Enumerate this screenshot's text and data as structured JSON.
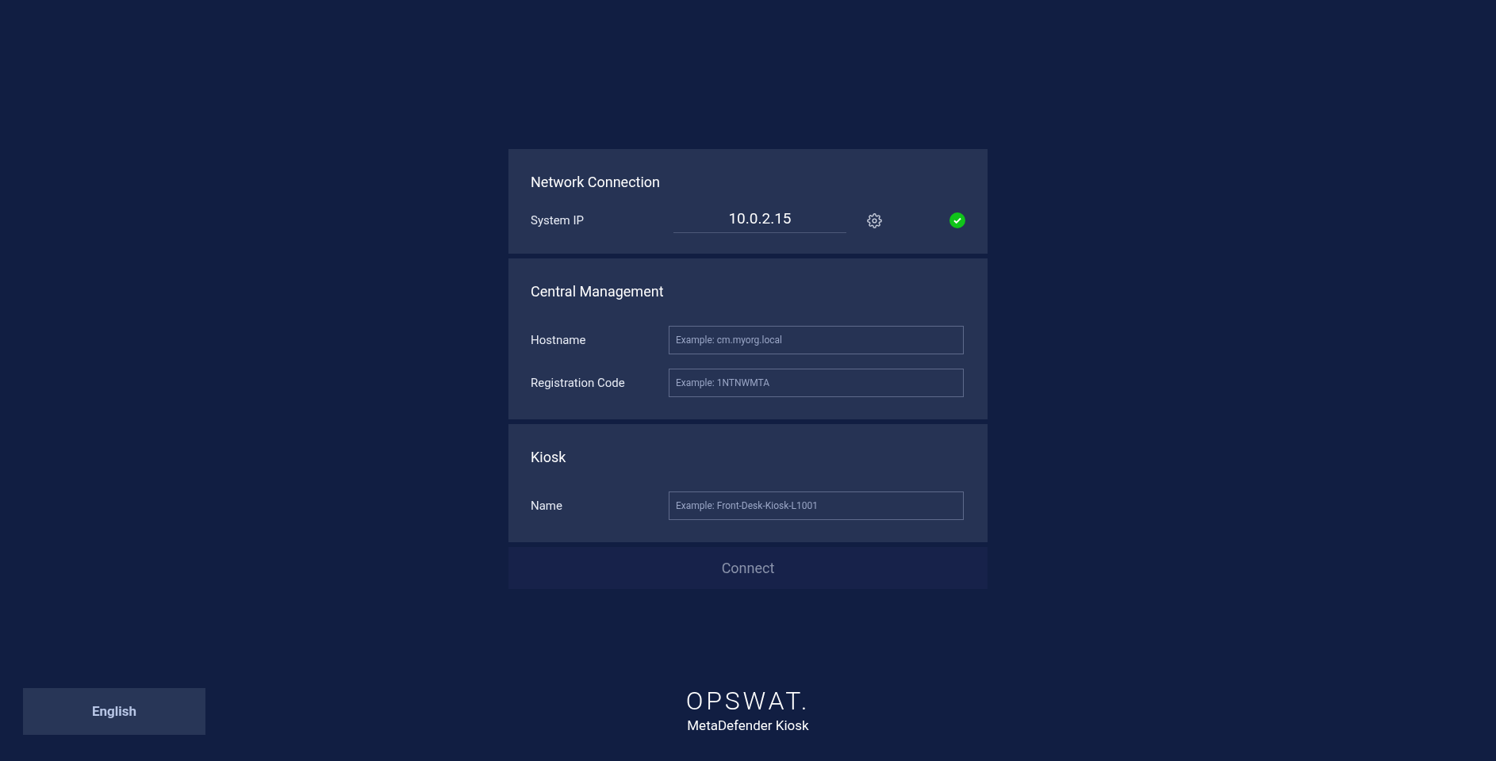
{
  "network": {
    "title": "Network Connection",
    "ip_label": "System IP",
    "ip_value": "10.0.2.15",
    "connected": true
  },
  "central_management": {
    "title": "Central Management",
    "fields": [
      {
        "label": "Hostname",
        "placeholder": "Example: cm.myorg.local"
      },
      {
        "label": "Registration Code",
        "placeholder": "Example: 1NTNWMTA"
      }
    ]
  },
  "kiosk": {
    "title": "Kiosk",
    "fields": [
      {
        "label": "Name",
        "placeholder": "Example: Front-Desk-Kiosk-L1001"
      }
    ]
  },
  "connect_button": {
    "label": "Connect",
    "disabled": true
  },
  "language_button": {
    "label": "English"
  },
  "brand": {
    "logo": "OPSWAT.",
    "product": "MetaDefender Kiosk"
  }
}
